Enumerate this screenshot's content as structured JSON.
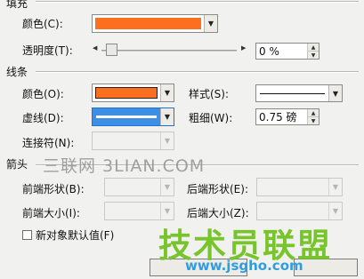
{
  "fill": {
    "group_title": "填充",
    "color_label": "颜色(C):",
    "color_value": "#fb6f1f",
    "transparency_label": "透明度(T):",
    "transparency_value": "0 %",
    "transparency_level": 0
  },
  "line": {
    "group_title": "线条",
    "color_label": "颜色(O):",
    "color_value": "#fb6f1f",
    "style_label": "样式(S):",
    "dash_label": "虚线(D):",
    "dash_color": "#1b73d3",
    "weight_label": "粗细(W):",
    "weight_value": "0.75 磅",
    "connector_label": "连接符(N):"
  },
  "arrows": {
    "group_title": "箭头",
    "begin_style_label": "前端形状(B):",
    "end_style_label": "后端形状(E):",
    "begin_size_label": "前端大小(I):",
    "end_size_label": "后端大小(Z):"
  },
  "default_checkbox_label": "新对象默认值(F)",
  "watermark": {
    "site_text": "三联网 3LIAN.COM",
    "logo_text": "技术员联盟",
    "url_text": "www.jsgho.com"
  }
}
